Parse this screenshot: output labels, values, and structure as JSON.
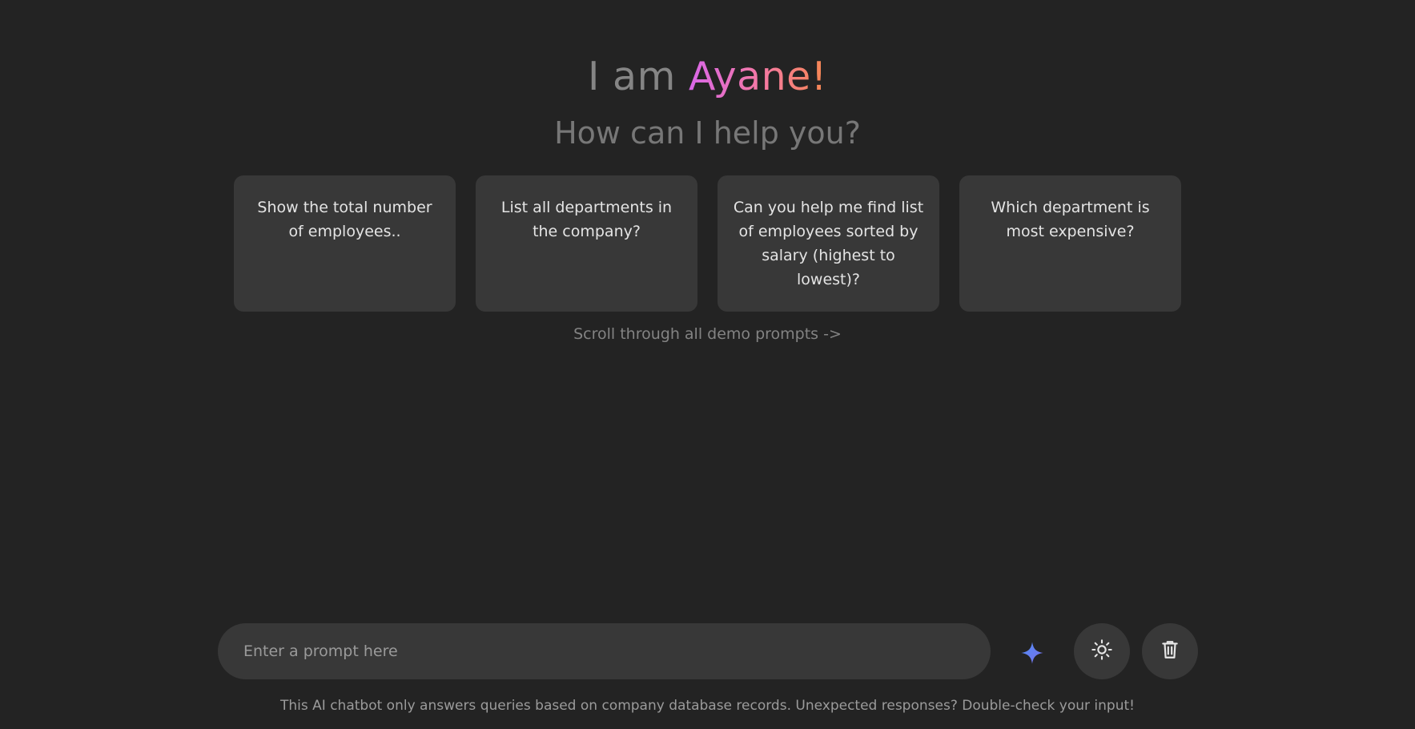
{
  "header": {
    "greeting_prefix": "I am ",
    "assistant_name": "Ayane!",
    "subtitle": "How can I help you?"
  },
  "suggestions": [
    {
      "text": "Show the total number of employees.."
    },
    {
      "text": "List all departments in the company?"
    },
    {
      "text": "Can you help me find list of employees sorted by salary (highest to lowest)?"
    },
    {
      "text": "Which department is most expensive?"
    }
  ],
  "scroll_hint": "Scroll through all demo prompts ->",
  "prompt": {
    "placeholder": "Enter a prompt here",
    "value": ""
  },
  "icons": {
    "send": "sparkle-icon",
    "theme": "sun-icon",
    "delete": "trash-icon"
  },
  "colors": {
    "background": "#232323",
    "card": "#383838",
    "name_gradient_start": "#d866e8",
    "name_gradient_end": "#f5874f",
    "sparkle_start": "#4f8ef7",
    "sparkle_end": "#7a6ee8"
  },
  "disclaimer": "This AI chatbot only answers queries based on company database records. Unexpected responses? Double-check your input!"
}
